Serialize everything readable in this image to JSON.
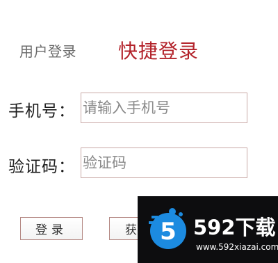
{
  "tabs": {
    "user_login": "用户登录",
    "quick_login": "快捷登录"
  },
  "form": {
    "phone": {
      "label": "手机号：",
      "placeholder": "请输入手机号"
    },
    "code": {
      "label": "验证码：",
      "placeholder": "验证码"
    }
  },
  "buttons": {
    "login": "登录",
    "get_code": "获"
  },
  "watermark": {
    "logo_text": "592下载",
    "logo_mark": "5",
    "url": "www.592xiazai.com"
  },
  "colors": {
    "quick_login_active": "#b3232b",
    "input_border": "#c9a9a6",
    "watermark_bg": "#0d0d0f",
    "watermark_accent": "#1c8be0"
  }
}
